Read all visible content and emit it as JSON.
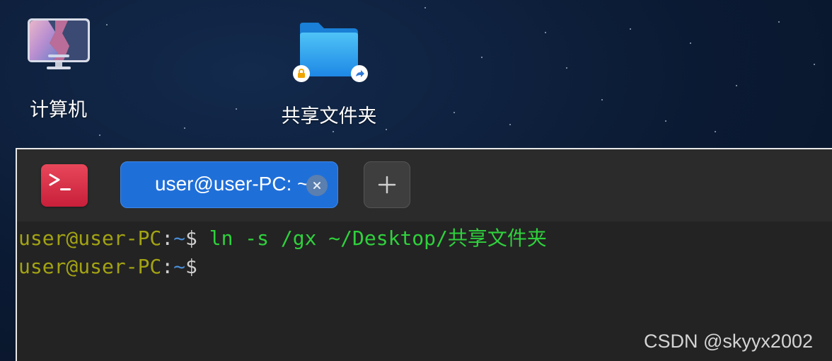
{
  "desktop": {
    "icons": [
      {
        "label": "计算机",
        "icon": "computer-monitor-icon"
      },
      {
        "label": "共享文件夹",
        "icon": "shared-folder-icon"
      }
    ]
  },
  "terminal": {
    "tab_title": "user@user-PC: ~",
    "lines": [
      {
        "user": "user@user-PC",
        "sep": ":",
        "path": "~",
        "prompt": "$",
        "command": " ln -s /gx ~/Desktop/共享文件夹"
      },
      {
        "user": "user@user-PC",
        "sep": ":",
        "path": "~",
        "prompt": "$",
        "command": ""
      }
    ]
  },
  "watermark": "CSDN @skyyx2002",
  "colors": {
    "tab_active": "#1f6fd9",
    "prompt_user": "#a3a313",
    "prompt_path": "#4a8fd8",
    "command_text": "#2fd13c",
    "terminal_bg": "#232323"
  }
}
